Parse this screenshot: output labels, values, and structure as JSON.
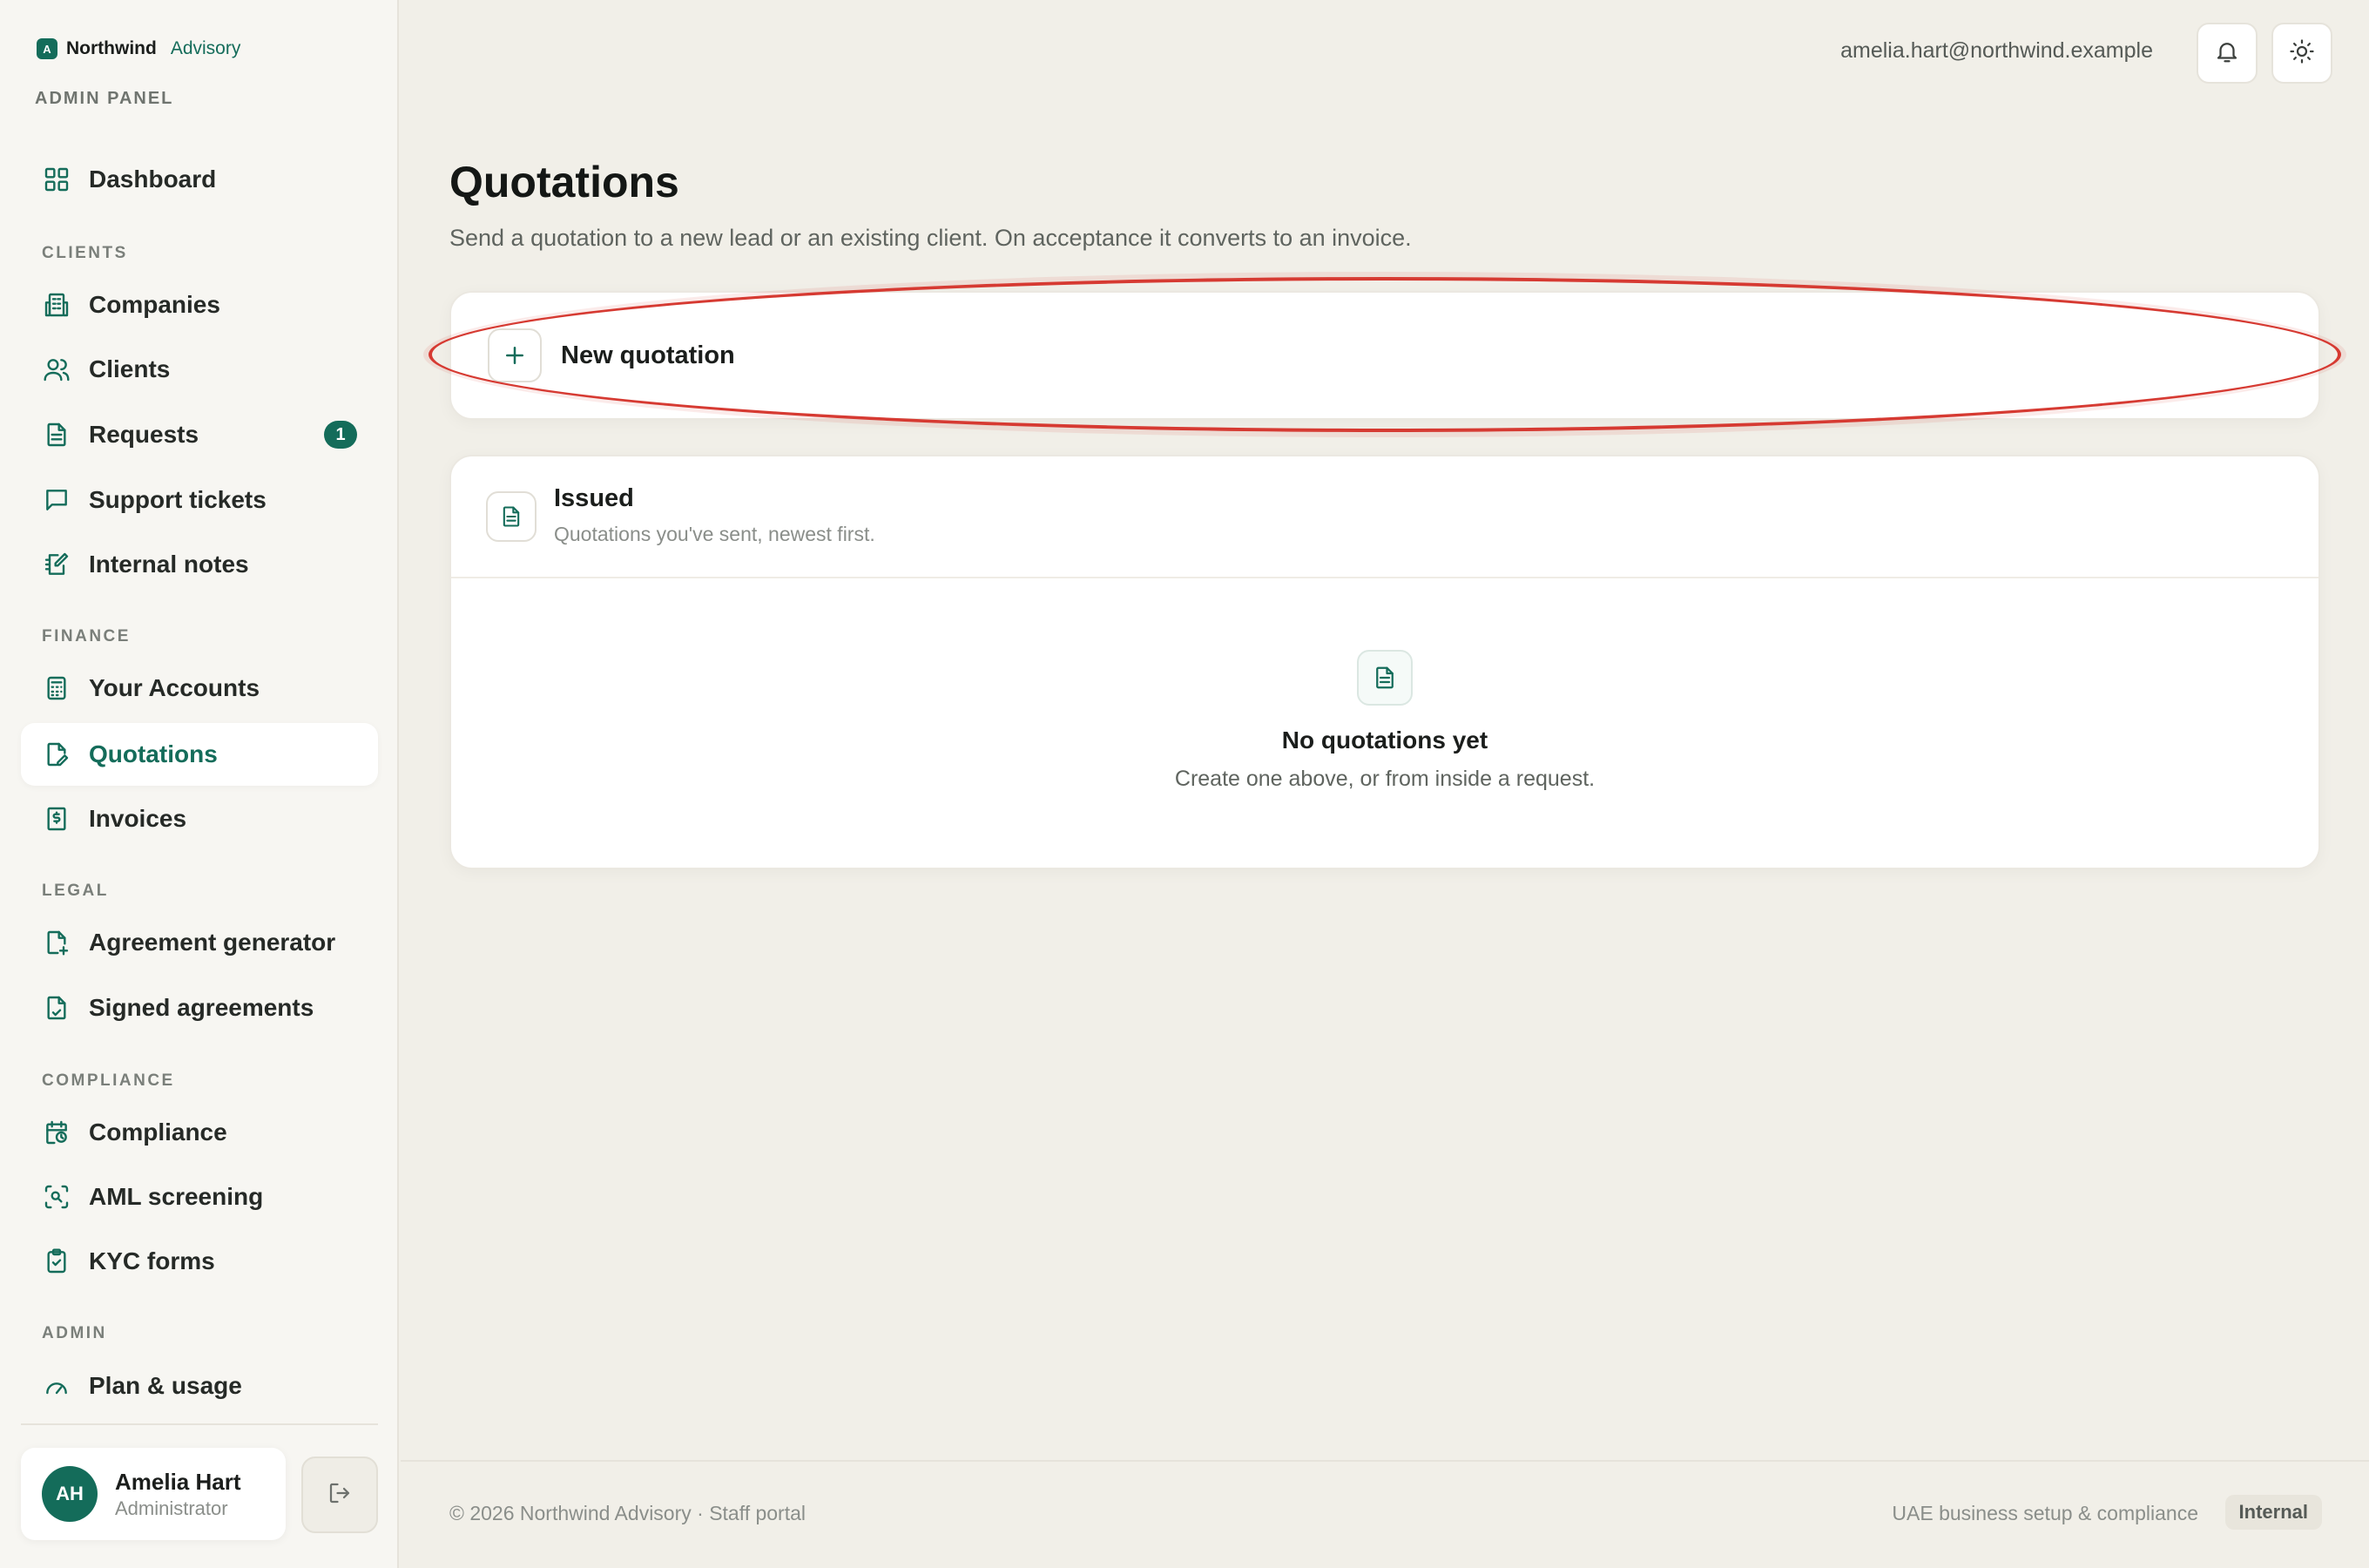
{
  "brand": {
    "logo_letter": "A",
    "name": "Northwind",
    "sub": "Advisory"
  },
  "panel_label": "ADMIN PANEL",
  "sidebar": {
    "dashboard": "Dashboard",
    "sections": {
      "clients": "CLIENTS",
      "finance": "FINANCE",
      "legal": "LEGAL",
      "compliance": "COMPLIANCE",
      "admin": "ADMIN"
    },
    "items": {
      "companies": "Companies",
      "clients": "Clients",
      "requests": "Requests",
      "requests_badge": "1",
      "support_tickets": "Support tickets",
      "internal_notes": "Internal notes",
      "your_accounts": "Your Accounts",
      "quotations": "Quotations",
      "invoices": "Invoices",
      "agreement_generator": "Agreement generator",
      "signed_agreements": "Signed agreements",
      "compliance": "Compliance",
      "aml_screening": "AML screening",
      "kyc_forms": "KYC forms",
      "plan_usage": "Plan & usage"
    },
    "active_item": "quotations"
  },
  "user": {
    "initials": "AH",
    "name": "Amelia Hart",
    "role": "Administrator"
  },
  "topbar": {
    "email": "amelia.hart@northwind.example",
    "icons": [
      "bell-icon",
      "sun-icon"
    ]
  },
  "main": {
    "title": "Quotations",
    "subtitle": "Send a quotation to a new lead or an existing client. On acceptance it converts to an invoice.",
    "new_quotation_label": "New quotation",
    "issued": {
      "title": "Issued",
      "subtitle": "Quotations you've sent, newest first.",
      "empty_title": "No quotations yet",
      "empty_sub": "Create one above, or from inside a request."
    }
  },
  "footer": {
    "left": "© 2026 Northwind Advisory · Staff portal",
    "right": "UAE business setup & compliance",
    "badge": "Internal"
  },
  "colors": {
    "accent": "#146c5a",
    "highlight": "#d63a32",
    "background": "#f1efe8"
  }
}
